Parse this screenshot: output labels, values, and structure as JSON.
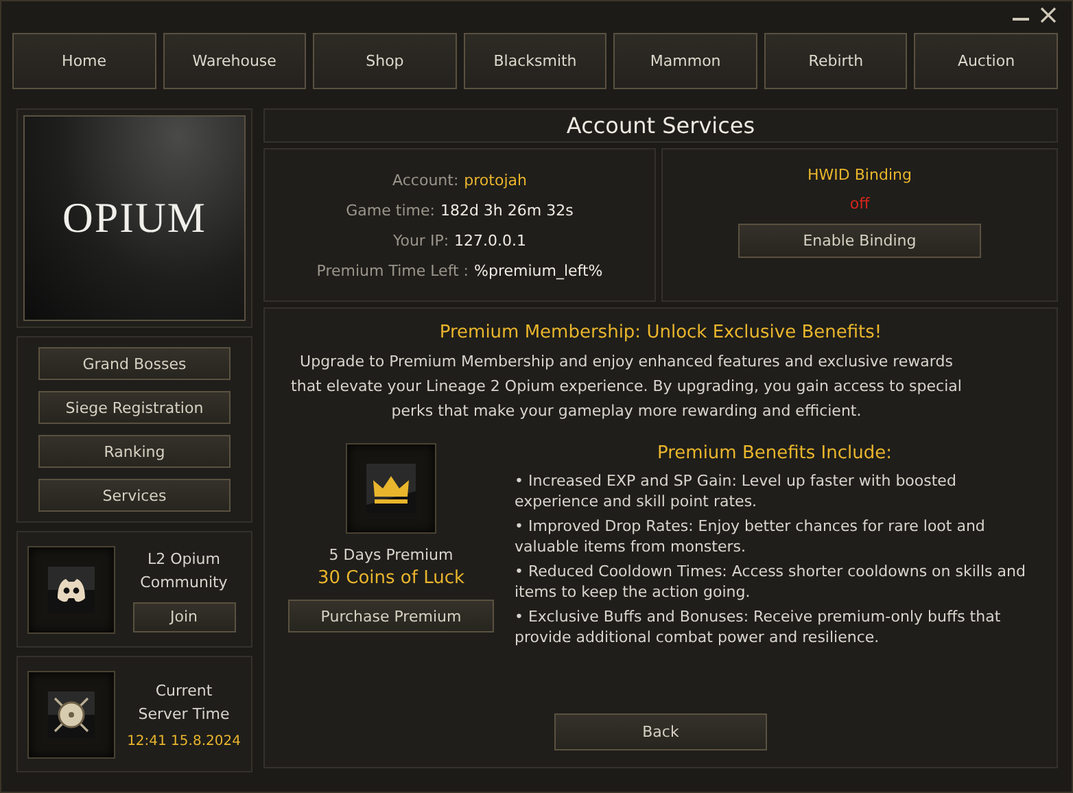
{
  "nav_tabs": [
    {
      "label": "Home",
      "selected": false
    },
    {
      "label": "Warehouse",
      "selected": false
    },
    {
      "label": "Shop",
      "selected": false
    },
    {
      "label": "Blacksmith",
      "selected": false
    },
    {
      "label": "Mammon",
      "selected": false
    },
    {
      "label": "Rebirth",
      "selected": false
    },
    {
      "label": "Auction",
      "selected": false
    }
  ],
  "logo": "OPIUM",
  "side_menu": [
    "Grand Bosses",
    "Siege Registration",
    "Ranking",
    "Services"
  ],
  "community": {
    "title": "L2 Opium Community",
    "button": "Join"
  },
  "server_time": {
    "title": "Current Server Time",
    "value": "12:41 15.8.2024"
  },
  "page_title": "Account Services",
  "account_info": [
    {
      "label": "Account:",
      "value": "protojah",
      "highlight": true
    },
    {
      "label": "Game time:",
      "value": "182d 3h 26m 32s",
      "highlight": false
    },
    {
      "label": "Your IP:",
      "value": "127.0.0.1",
      "highlight": false
    },
    {
      "label": "Premium Time Left :",
      "value": "%premium_left%",
      "highlight": false
    }
  ],
  "hwid": {
    "title": "HWID Binding",
    "on": false,
    "status": "off",
    "button": "Enable Binding"
  },
  "premium": {
    "heading": "Premium Membership: Unlock Exclusive Benefits!",
    "intro": "Upgrade to Premium Membership and enjoy enhanced features and exclusive rewards that elevate your Lineage 2 Opium experience. By upgrading, you gain access to special perks that make your gameplay more rewarding and efficient.",
    "offer_name": "5 Days Premium",
    "price": "30 Coins of Luck",
    "buy_button": "Purchase Premium",
    "benefits_title": "Premium Benefits Include:",
    "benefits": [
      "• Increased EXP and SP Gain: Level up faster with boosted experience and skill point rates.",
      "• Improved Drop Rates: Enjoy better chances for rare loot and valuable items from monsters.",
      "• Reduced Cooldown Times: Access shorter cooldowns on skills and items to keep the action going.",
      "• Exclusive Buffs and Bonuses: Receive premium-only buffs that provide additional combat power and resilience."
    ]
  },
  "back_button": "Back"
}
